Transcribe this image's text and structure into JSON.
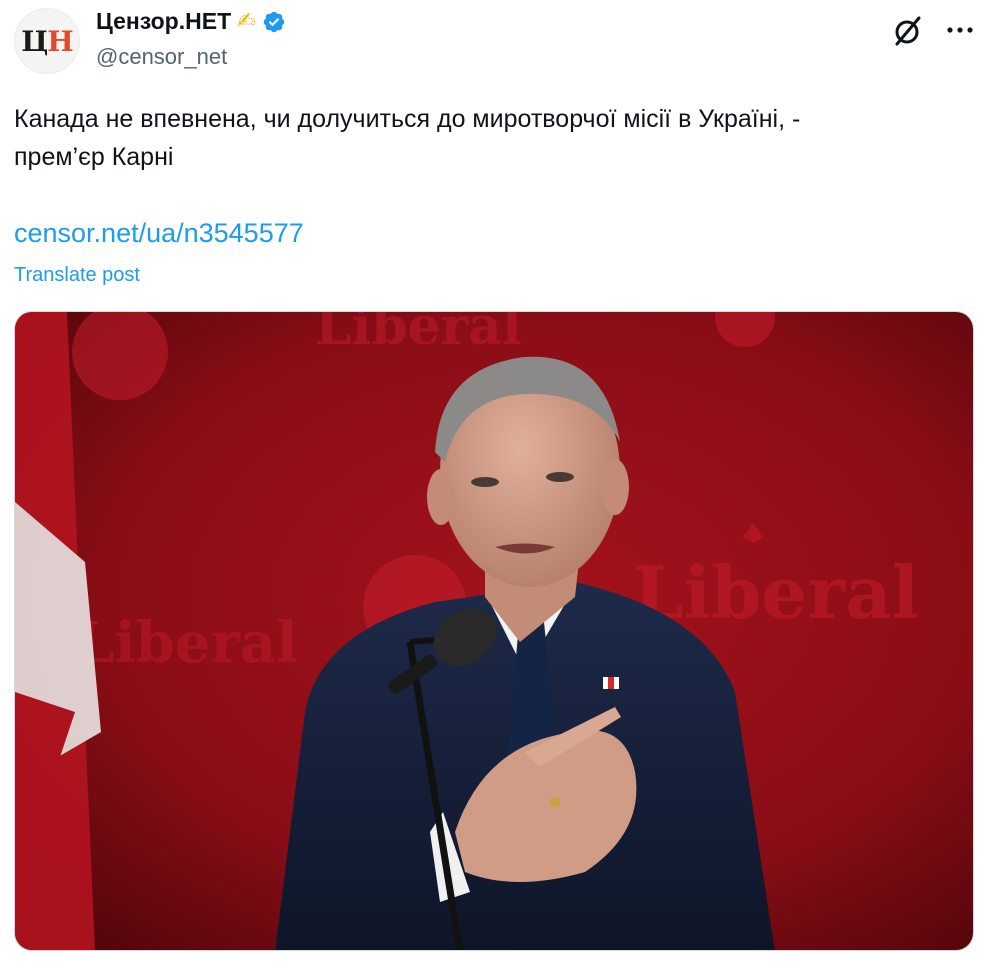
{
  "author": {
    "avatar_text_1": "Ц",
    "avatar_text_2": "Н",
    "display_name": "Цензор.НЕТ",
    "emoji": "✍",
    "handle": "@censor_net"
  },
  "post": {
    "text": "Канада не впевнена, чи долучиться до миротворчої місії в Україні, -\nпрем’єр Карні",
    "link": "censor.net/ua/n3545577",
    "translate_label": "Translate post"
  },
  "media": {
    "backdrop_word": "Liberal"
  },
  "colors": {
    "accent": "#1d9bf0",
    "text_primary": "#0f1419",
    "text_secondary": "#536471",
    "backdrop_red": "#8f0f18"
  },
  "icons": {
    "verified": "verified-badge-icon",
    "grok": "grok-icon",
    "more": "more-options-icon"
  }
}
